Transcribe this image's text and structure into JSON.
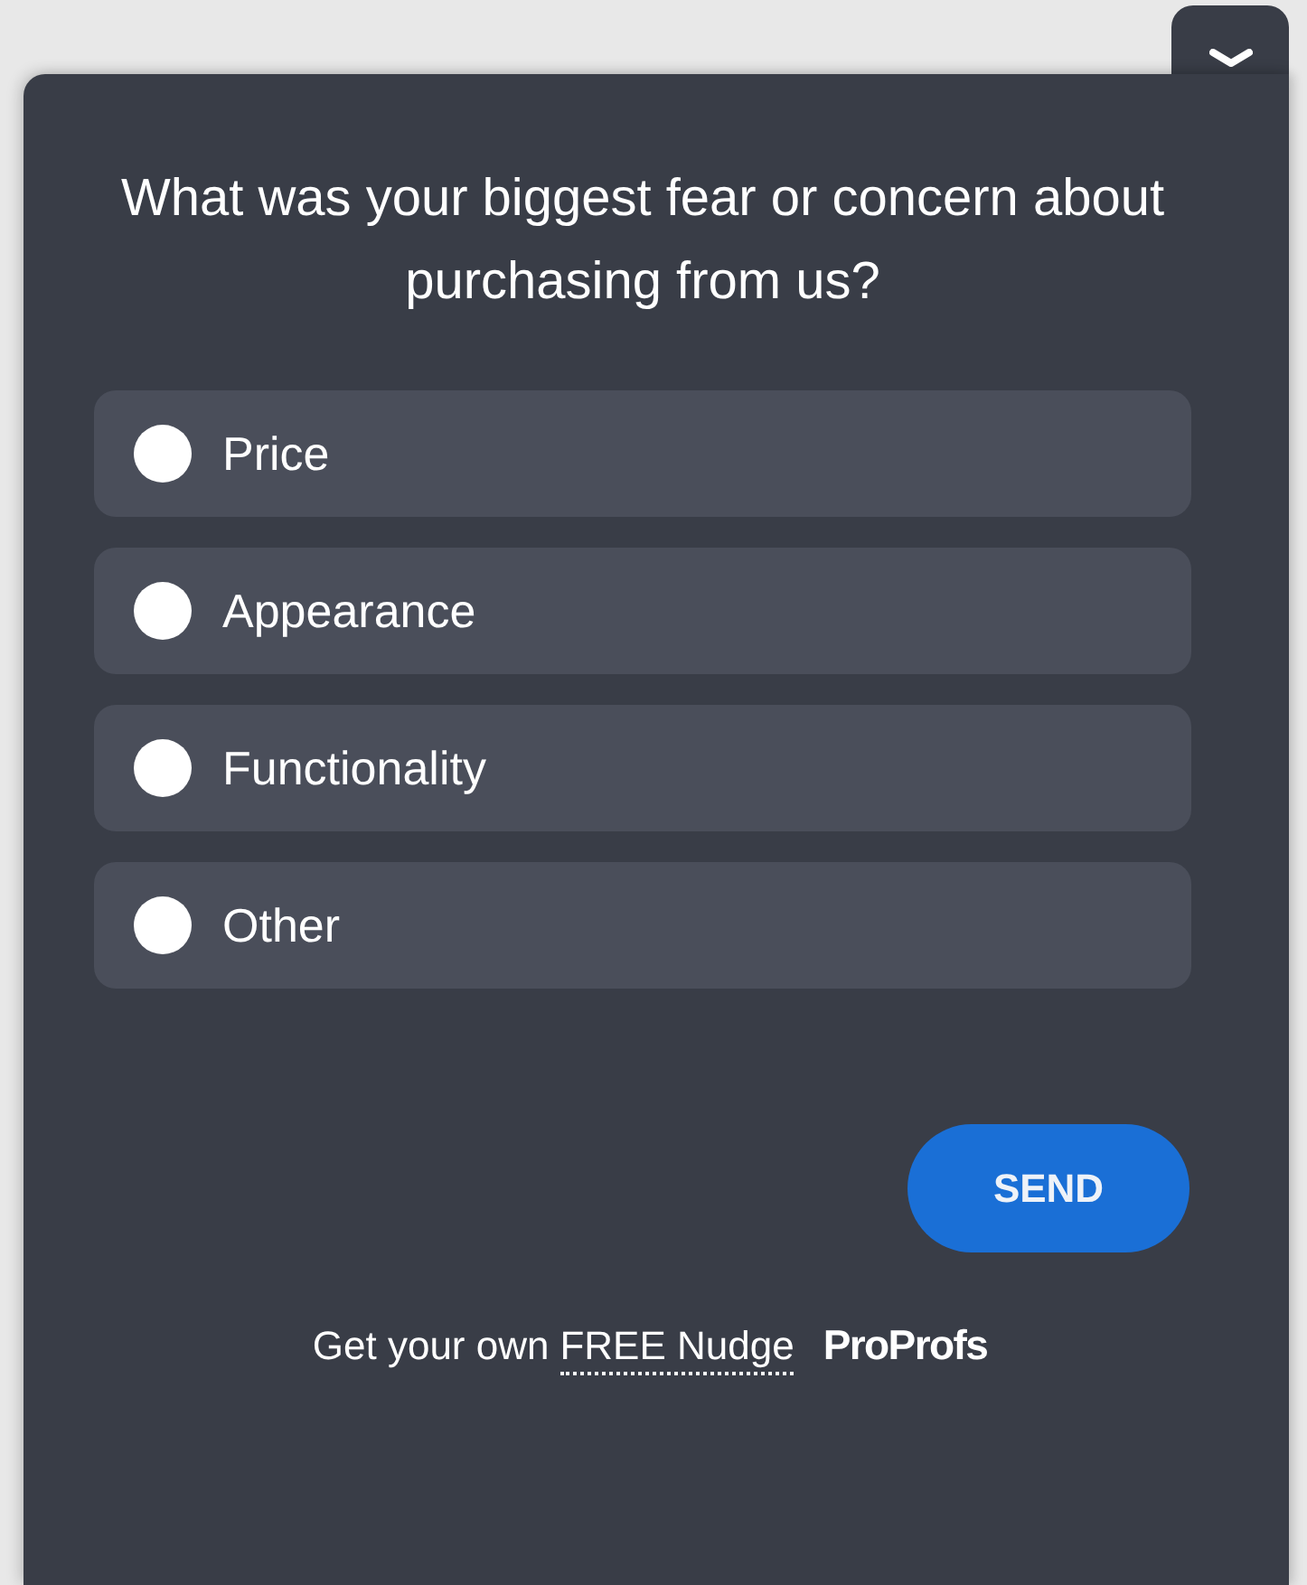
{
  "collapse_toggle": {
    "expanded": true
  },
  "question": "What was your biggest fear or concern about purchasing from us?",
  "options": [
    {
      "label": "Price",
      "selected": false
    },
    {
      "label": "Appearance",
      "selected": false
    },
    {
      "label": "Functionality",
      "selected": false
    },
    {
      "label": "Other",
      "selected": false
    }
  ],
  "submit_button": "SEND",
  "footer": {
    "text": "Get your own",
    "link": "FREE Nudge",
    "logo": "ProProfs"
  }
}
